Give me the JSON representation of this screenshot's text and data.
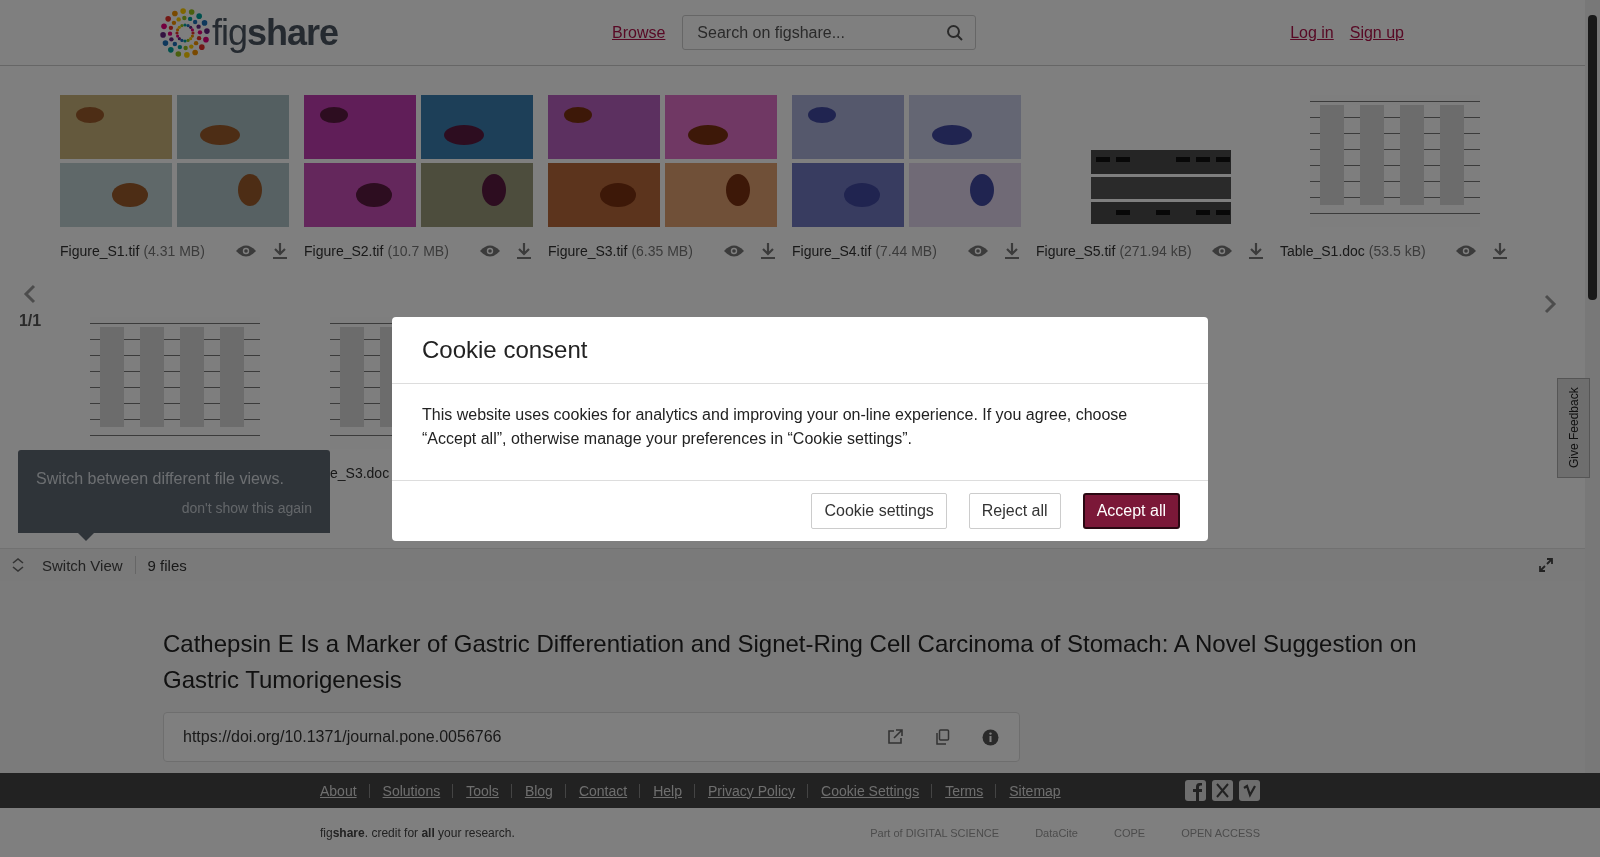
{
  "header": {
    "logo": "fig**share**",
    "nav_link": "Browse",
    "search": {
      "placeholder": "Search on figshare..."
    },
    "auth_links": [
      "Log in",
      "Sign up"
    ]
  },
  "gallery": {
    "page_indicator": "1/1",
    "files": [
      {
        "kind": "picture",
        "name": "Figure_S1.tif",
        "size": "(4.31 MB)"
      },
      {
        "kind": "picture",
        "name": "Figure_S2.tif",
        "size": "(10.7 MB)"
      },
      {
        "kind": "picture",
        "name": "Figure_S3.tif",
        "size": "(6.35 MB)"
      },
      {
        "kind": "picture",
        "name": "Figure_S4.tif",
        "size": "(7.44 MB)"
      },
      {
        "kind": "picture",
        "name": "Figure_S5.tif",
        "size": "(271.94 kB)"
      },
      {
        "kind": "picture",
        "name": "Table_S1.doc",
        "size": "(53.5 kB)"
      }
    ],
    "second_row": [
      {
        "kind": "picture"
      },
      {
        "kind": "picture",
        "caption": "e_S3.doc"
      }
    ]
  },
  "tooltip": {
    "text": "Switch between different file views.",
    "dismiss": "don't show this again"
  },
  "view_bar": {
    "switch_label": "Switch View",
    "file_count": "9 files"
  },
  "article": {
    "title": "Cathepsin E Is a Marker of Gastric Differentiation and Signet-Ring Cell Carcinoma of Stomach: A Novel Suggestion on Gastric Tumorigenesis",
    "doi": "https://doi.org/10.1371/journal.pone.0056766"
  },
  "feedback_tab": "Give Feedback",
  "footer": {
    "links": [
      "About",
      "Solutions",
      "Tools",
      "Blog",
      "Contact",
      "Help",
      "Privacy Policy",
      "Cookie Settings",
      "Terms",
      "Sitemap"
    ],
    "tagline": "fig**share**. credit for **all** your research.",
    "partners": [
      "Part of DIGITAL SCIENCE",
      "DataCite",
      "COPE",
      "OPEN ACCESS"
    ]
  },
  "cookie_dialog": {
    "title": "Cookie consent",
    "body": "This website uses cookies for analytics and improving your on-line experience. If you agree, choose “Accept all”, otherwise manage your preferences in “Cookie settings”.",
    "buttons": [
      {
        "label": "Cookie settings",
        "primary": false
      },
      {
        "label": "Reject all",
        "primary": false
      },
      {
        "label": "Accept all",
        "primary": true
      }
    ]
  }
}
